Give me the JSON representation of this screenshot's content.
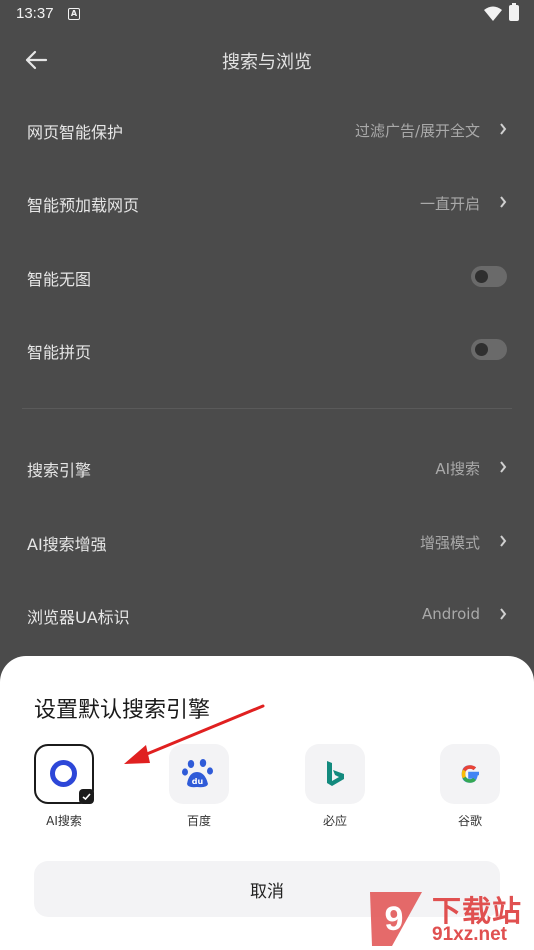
{
  "status_bar": {
    "time": "13:37",
    "notif_letter": "A"
  },
  "header": {
    "title": "搜索与浏览"
  },
  "settings": [
    {
      "label": "网页智能保护",
      "value": "过滤广告/展开全文",
      "kind": "link"
    },
    {
      "label": "智能预加载网页",
      "value": "一直开启",
      "kind": "link"
    },
    {
      "label": "智能无图",
      "kind": "toggle",
      "on": false
    },
    {
      "label": "智能拼页",
      "kind": "toggle",
      "on": false
    },
    {
      "label": "搜索引擎",
      "value": "AI搜索",
      "kind": "link"
    },
    {
      "label": "AI搜索增强",
      "value": "增强模式",
      "kind": "link"
    },
    {
      "label": "浏览器UA标识",
      "value": "Android",
      "kind": "link"
    }
  ],
  "sheet": {
    "title": "设置默认搜索引擎",
    "engines": [
      {
        "label": "AI搜索",
        "icon": "ai-search-icon",
        "selected": true
      },
      {
        "label": "百度",
        "icon": "baidu-icon",
        "selected": false
      },
      {
        "label": "必应",
        "icon": "bing-icon",
        "selected": false
      },
      {
        "label": "谷歌",
        "icon": "google-icon",
        "selected": false
      }
    ],
    "cancel_label": "取消"
  },
  "watermark": {
    "text": "下载站",
    "url": "91xz.net",
    "logo": "9"
  },
  "colors": {
    "annotation": "#e02020",
    "baidu": "#2f5bd8",
    "bing": "#138a7e",
    "ai_search": "#2d47d8"
  }
}
